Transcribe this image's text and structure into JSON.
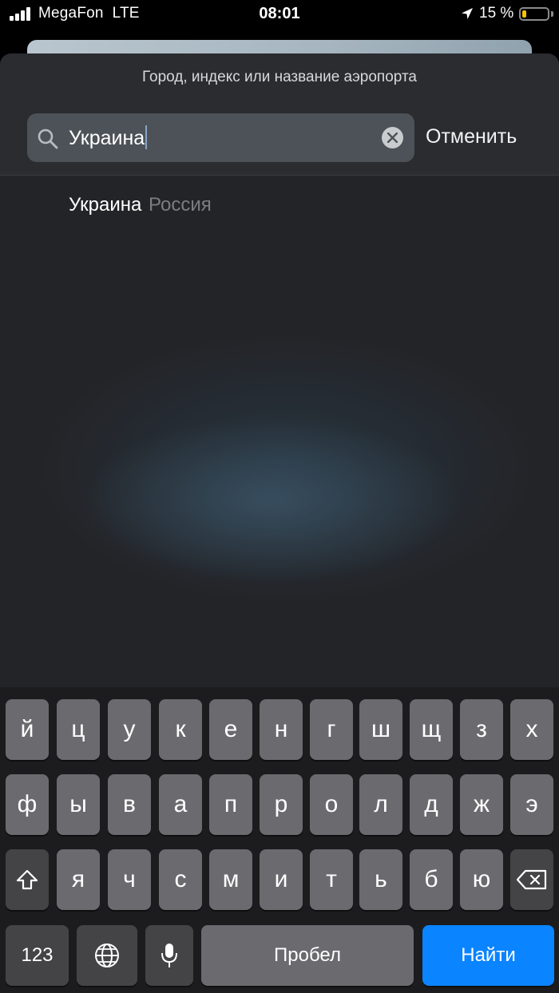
{
  "status_bar": {
    "carrier": "MegaFon",
    "network": "LTE",
    "time": "08:01",
    "battery_percent": "15 %",
    "battery_level": 0.15,
    "battery_color": "#f5c400"
  },
  "search": {
    "prompt": "Город, индекс или название аэропорта",
    "value": "Украина",
    "cancel_label": "Отменить"
  },
  "results": [
    {
      "primary": "Украина",
      "secondary": "Россия"
    }
  ],
  "keyboard": {
    "row1": [
      "й",
      "ц",
      "у",
      "к",
      "е",
      "н",
      "г",
      "ш",
      "щ",
      "з",
      "х"
    ],
    "row2": [
      "ф",
      "ы",
      "в",
      "а",
      "п",
      "р",
      "о",
      "л",
      "д",
      "ж",
      "э"
    ],
    "row3": [
      "я",
      "ч",
      "с",
      "м",
      "и",
      "т",
      "ь",
      "б",
      "ю"
    ],
    "numbers_label": "123",
    "space_label": "Пробел",
    "return_label": "Найти",
    "accent_color": "#0a84ff"
  }
}
